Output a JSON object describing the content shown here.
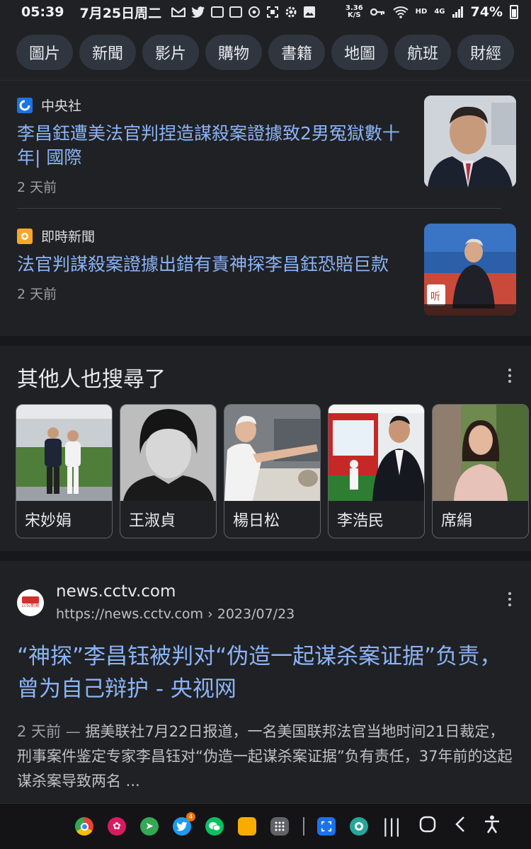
{
  "status_bar": {
    "time": "05:39",
    "date": "7月25日周二",
    "net_speed_value": "3.36",
    "net_speed_unit": "K/S",
    "network_type": "4G",
    "hd": "HD",
    "battery": "74%"
  },
  "chips": [
    "圖片",
    "新聞",
    "影片",
    "購物",
    "書籍",
    "地圖",
    "航班",
    "財經"
  ],
  "news": [
    {
      "source": "中央社",
      "title": "李昌鈺遭美法官判捏造謀殺案證據致2男冤獄數十年| 國際",
      "time": "2 天前"
    },
    {
      "source": "即時新聞",
      "title": "法官判謀殺案證據出錯有責神探李昌鈺恐賠巨款",
      "time": "2 天前"
    }
  ],
  "people_also_search": {
    "title": "其他人也搜尋了",
    "people": [
      "宋妙娟",
      "王淑貞",
      "楊日松",
      "李浩民",
      "席絹"
    ]
  },
  "result": {
    "favicon_text": "cctv新闻",
    "site": "news.cctv.com",
    "url": "https://news.cctv.com",
    "url_date": "› 2023/07/23",
    "title": "“神探”李昌钰被判对“伪造一起谋杀案证据”负责，曾为自己辩护 - 央视网",
    "snippet_date": "2 天前 —",
    "snippet": "据美联社7月22日报道，一名美国联邦法官当地时间21日裁定，刑事案件鉴定专家李昌钰对“伪造一起谋杀案证据”负有责任，37年前的这起谋杀案导致两名 ..."
  },
  "navbar": {
    "twitter_badge": "4"
  }
}
